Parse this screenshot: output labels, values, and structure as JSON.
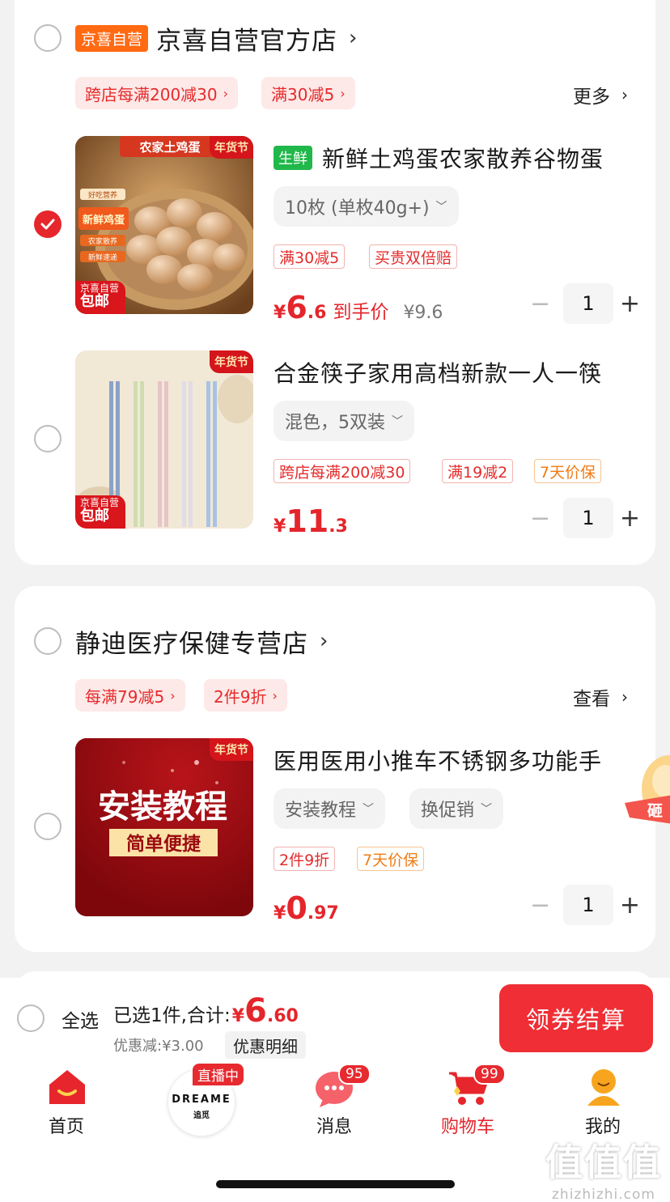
{
  "colors": {
    "accent": "#e4262c",
    "self_badge": "#ff6a13",
    "fresh_badge": "#20b84a",
    "checkout": "#ef2e35"
  },
  "stores": [
    {
      "name": "京喜自营官方店",
      "badge": "京喜自营",
      "promos": [
        "跨店每满200减30",
        "满30减5"
      ],
      "more_label": "更多",
      "products": [
        {
          "checked": true,
          "fresh_tag": "生鲜",
          "title": "新鲜土鸡蛋农家散养谷物蛋",
          "spec": "10枚 (单枚40g+)",
          "tags": [
            "满30减5",
            "买贵双倍赔"
          ],
          "price_symbol": "¥",
          "price_int": "6",
          "price_dec": ".6",
          "price_label": "到手价",
          "orig_price": "¥9.6",
          "qty": "1",
          "thumb": {
            "banner": "农家土鸡蛋",
            "new_year": "年货节",
            "side1": "好吃营养",
            "side2": "新鲜鸡蛋",
            "side3": "农家散养",
            "side4": "新鲜速递",
            "ship_top": "京喜自营",
            "ship_bottom": "包邮"
          }
        },
        {
          "checked": false,
          "title": "合金筷子家用高档新款一人一筷",
          "spec": "混色，5双装",
          "tags": [
            "跨店每满200减30",
            "满19减2",
            "7天价保"
          ],
          "price_symbol": "¥",
          "price_int": "11",
          "price_dec": ".3",
          "qty": "1",
          "thumb": {
            "new_year": "年货节",
            "ship_top": "京喜自营",
            "ship_bottom": "包邮"
          }
        }
      ]
    },
    {
      "name": "静迪医疗保健专营店",
      "promos": [
        "每满79减5",
        "2件9折"
      ],
      "more_label": "查看",
      "products": [
        {
          "checked": false,
          "title": "医用医用小推车不锈钢多功能手",
          "specs": [
            "安装教程",
            "换促销"
          ],
          "tags": [
            "2件9折",
            "7天价保"
          ],
          "price_symbol": "¥",
          "price_int": "0",
          "price_dec": ".97",
          "qty": "1",
          "thumb": {
            "line1": "安装教程",
            "line2": "简单便捷",
            "new_year": "年货节"
          }
        }
      ]
    }
  ],
  "float_deco_text": "砸",
  "bottom_bar": {
    "select_all": "全选",
    "summary_prefix": "已选1件,合计:",
    "total_symbol": "¥",
    "total_int": "6",
    "total_dec": ".60",
    "discount": "优惠减:¥3.00",
    "detail_button": "优惠明细",
    "checkout_button": "领券结算"
  },
  "tabbar": {
    "items": [
      {
        "label": "首页",
        "icon": "home-icon"
      },
      {
        "label": "",
        "icon": "live-brand-icon",
        "live_tag": "直播中",
        "brand": "DREAME",
        "brand_cn": "追觅"
      },
      {
        "label": "消息",
        "icon": "message-icon",
        "badge": "95"
      },
      {
        "label": "购物车",
        "icon": "cart-icon",
        "badge": "99",
        "active": true
      },
      {
        "label": "我的",
        "icon": "profile-icon"
      }
    ]
  },
  "watermark": {
    "big": "值值值",
    "small": "zhizhizhi.com"
  }
}
